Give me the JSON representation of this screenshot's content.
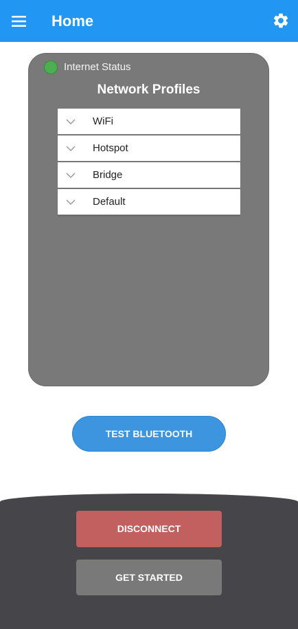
{
  "header": {
    "title": "Home",
    "menu_icon": "hamburger-menu-icon",
    "settings_icon": "gear-icon"
  },
  "status_card": {
    "status_label": "Internet Status",
    "status_color": "#4caf50",
    "heading": "Network Profiles",
    "profiles": [
      {
        "label": "WiFi"
      },
      {
        "label": "Hotspot"
      },
      {
        "label": "Bridge"
      },
      {
        "label": "Default"
      }
    ]
  },
  "actions": {
    "test_bluetooth_label": "TEST BLUETOOTH",
    "disconnect_label": "DISCONNECT",
    "get_started_label": "GET STARTED"
  },
  "colors": {
    "app_bar": "#2196F3",
    "card": "#797979",
    "test_button": "#3d95e0",
    "disconnect_button": "#c25f5f",
    "get_started_button": "#797979",
    "bottom_sheet": "#46464a"
  }
}
